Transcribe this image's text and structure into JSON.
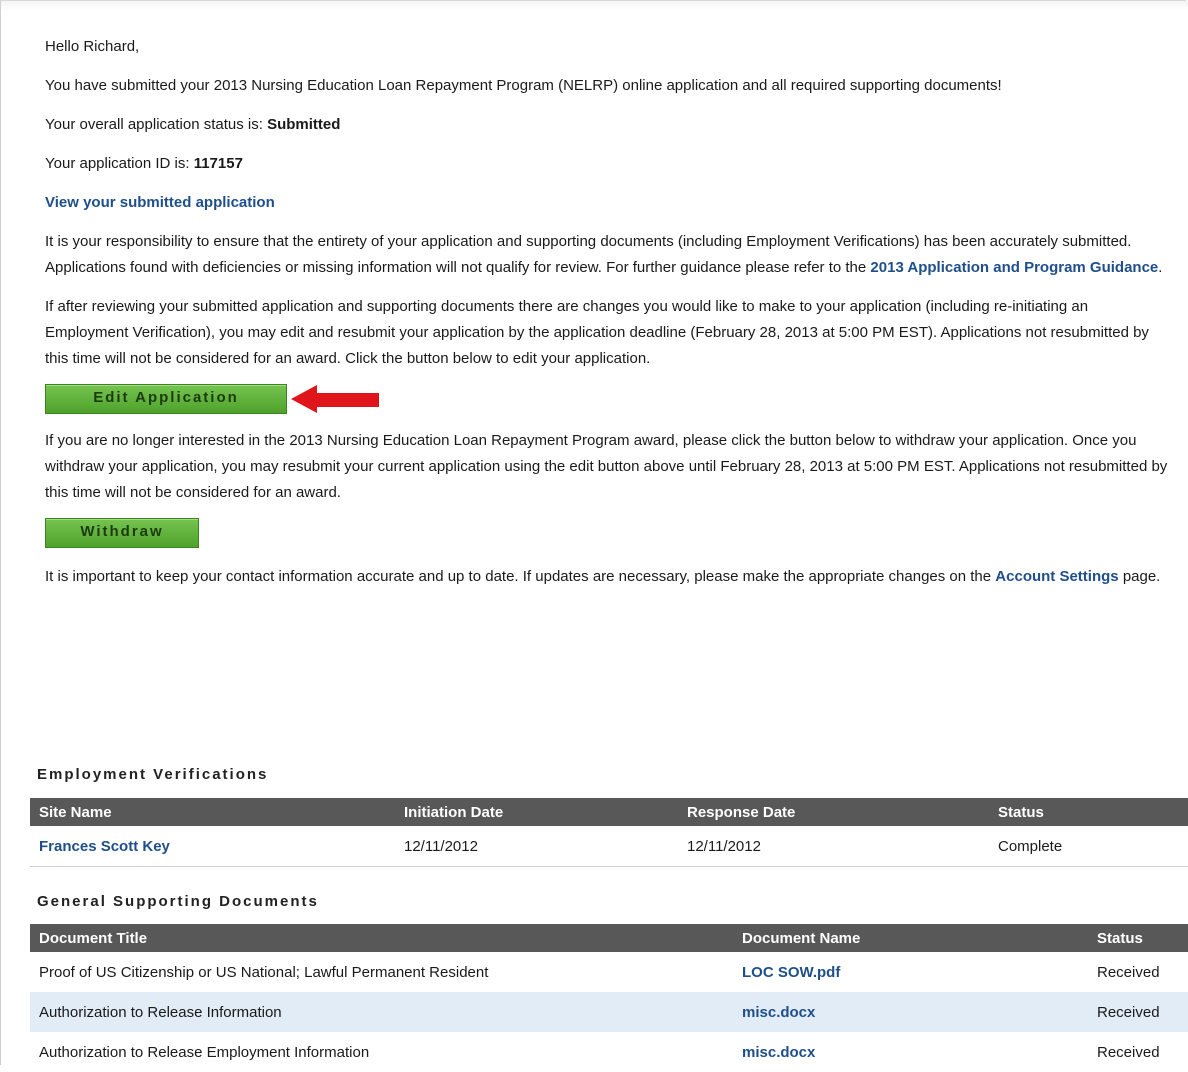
{
  "greeting": "Hello Richard,",
  "intro": "You have submitted your 2013 Nursing Education Loan Repayment Program (NELRP) online application and all required supporting documents!",
  "status": {
    "label": "Your overall application status is:",
    "value": "Submitted"
  },
  "app_id": {
    "label": "Your application ID is:",
    "value": "117157"
  },
  "view_link": "View your submitted application",
  "responsibility": {
    "text": "It is your responsibility to ensure that the entirety of your application and supporting documents (including Employment Verifications) has been accurately submitted. Applications found with deficiencies or missing information will not qualify for review. For further guidance please refer to the",
    "link": "2013 Application and Program Guidance",
    "tail": "."
  },
  "edit_info": "If after reviewing your submitted application and supporting documents there are changes you would like to make to your application (including re-initiating an Employment Verification), you may edit and resubmit your application by the application deadline (February 28, 2013 at 5:00 PM EST). Applications not resubmitted by this time will not be considered for an award. Click the button below to edit your application.",
  "edit_button": "Edit Application",
  "withdraw_info": "If you are no longer interested in the 2013 Nursing Education Loan Repayment Program award, please click the button below to withdraw your application. Once you withdraw your application, you may resubmit your current application using the edit button above until February 28, 2013 at 5:00 PM EST. Applications not resubmitted by this time will not be considered for an award.",
  "withdraw_button": "Withdraw",
  "contact": {
    "text": "It is important to keep your contact information accurate and up to date. If updates are necessary, please make the appropriate changes on the",
    "link": "Account Settings",
    "tail": "page."
  },
  "arrow_color": "#e0141b",
  "employment": {
    "title": "Employment Verifications",
    "headers": [
      "Site Name",
      "Initiation Date",
      "Response Date",
      "Status"
    ],
    "rows": [
      {
        "site": "Frances Scott Key",
        "initiation": "12/11/2012",
        "response": "12/11/2012",
        "status": "Complete"
      }
    ]
  },
  "general_docs": {
    "title": "General Supporting Documents",
    "headers": [
      "Document Title",
      "Document Name",
      "Status"
    ],
    "rows": [
      {
        "title": "Proof of US Citizenship or US National; Lawful Permanent Resident",
        "name": "LOC SOW.pdf",
        "status": "Received"
      },
      {
        "title": "Authorization to Release Information",
        "name": "misc.docx",
        "status": "Received"
      },
      {
        "title": "Authorization to Release Employment Information",
        "name": "misc.docx",
        "status": "Received"
      }
    ]
  }
}
